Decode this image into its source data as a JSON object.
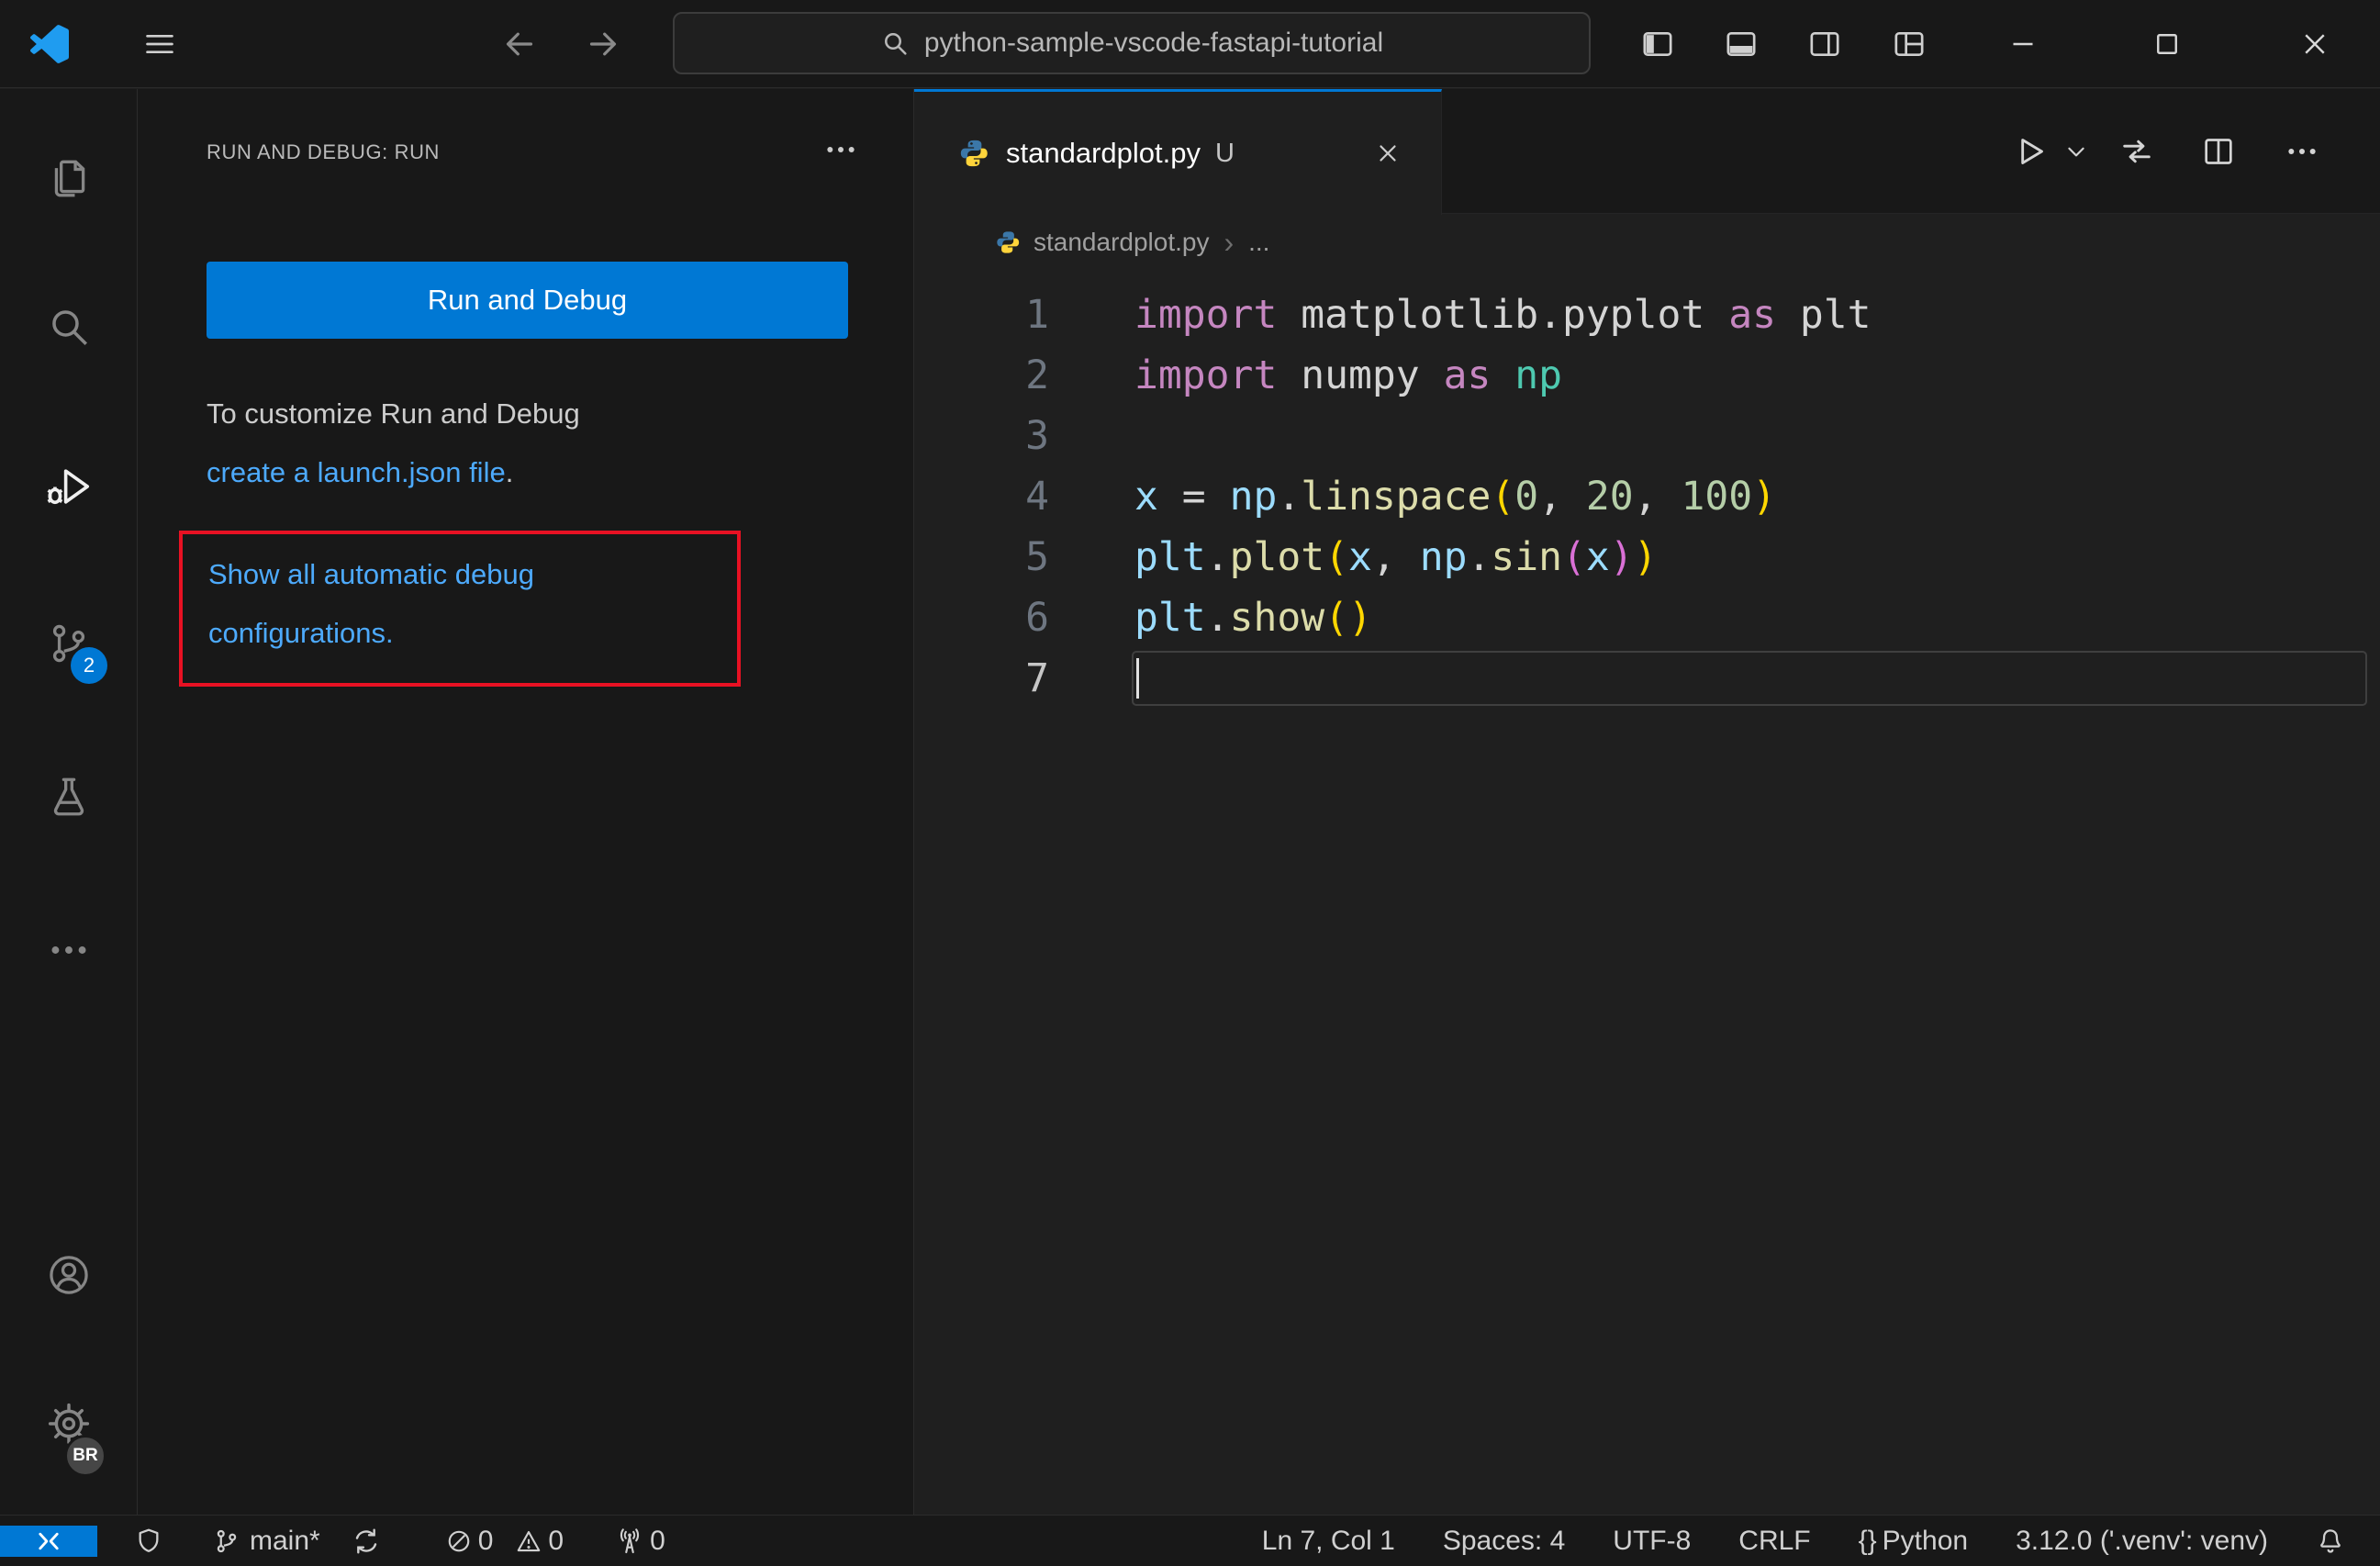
{
  "colors": {
    "accent": "#0078d4",
    "link_blue": "#4daafc",
    "highlight_red": "#e81123",
    "titlebar_bg": "#181818",
    "editor_bg": "#1f1f1f",
    "keyword": "#C586C0",
    "variable": "#9CDCFE",
    "function": "#DCDCAA",
    "number": "#B5CEA8",
    "bracket1": "#FFD700",
    "bracket2": "#DA70D6"
  },
  "title_bar": {
    "search": "python-sample-vscode-fastapi-tutorial"
  },
  "activity_bar": {
    "scm_badge": "2",
    "profile_badge": "BR"
  },
  "sidebar": {
    "header": "RUN AND DEBUG: RUN",
    "run_button": "Run and Debug",
    "hint_text": "To customize Run and Debug",
    "hint_link": "create a launch.json file",
    "hint_period": ".",
    "configs_link": "Show all automatic debug configurations."
  },
  "editor": {
    "tab": {
      "name": "standardplot.py",
      "git_status": "U"
    },
    "breadcrumb": {
      "file": "standardplot.py",
      "more": "..."
    },
    "lines": [
      {
        "num": "1",
        "tokens": [
          {
            "t": "import ",
            "c": "#C586C0"
          },
          {
            "t": "matplotlib.pyplot",
            "c": "#D4D4D4"
          },
          {
            "t": " ",
            "c": "#D4D4D4"
          },
          {
            "t": "as",
            "c": "#C586C0"
          },
          {
            "t": " plt",
            "c": "#D4D4D4"
          }
        ]
      },
      {
        "num": "2",
        "tokens": [
          {
            "t": "import ",
            "c": "#C586C0"
          },
          {
            "t": "numpy",
            "c": "#D4D4D4"
          },
          {
            "t": " ",
            "c": "#D4D4D4"
          },
          {
            "t": "as",
            "c": "#C586C0"
          },
          {
            "t": " np",
            "c": "#4EC9B0"
          }
        ]
      },
      {
        "num": "3",
        "tokens": []
      },
      {
        "num": "4",
        "tokens": [
          {
            "t": "x",
            "c": "#9CDCFE"
          },
          {
            "t": " = ",
            "c": "#D4D4D4"
          },
          {
            "t": "np",
            "c": "#9CDCFE"
          },
          {
            "t": ".",
            "c": "#D4D4D4"
          },
          {
            "t": "linspace",
            "c": "#DCDCAA"
          },
          {
            "t": "(",
            "c": "#FFD700"
          },
          {
            "t": "0",
            "c": "#B5CEA8"
          },
          {
            "t": ", ",
            "c": "#D4D4D4"
          },
          {
            "t": "20",
            "c": "#B5CEA8"
          },
          {
            "t": ", ",
            "c": "#D4D4D4"
          },
          {
            "t": "100",
            "c": "#B5CEA8"
          },
          {
            "t": ")",
            "c": "#FFD700"
          }
        ]
      },
      {
        "num": "5",
        "tokens": [
          {
            "t": "plt",
            "c": "#9CDCFE"
          },
          {
            "t": ".",
            "c": "#D4D4D4"
          },
          {
            "t": "plot",
            "c": "#DCDCAA"
          },
          {
            "t": "(",
            "c": "#FFD700"
          },
          {
            "t": "x",
            "c": "#9CDCFE"
          },
          {
            "t": ", ",
            "c": "#D4D4D4"
          },
          {
            "t": "np",
            "c": "#9CDCFE"
          },
          {
            "t": ".",
            "c": "#D4D4D4"
          },
          {
            "t": "sin",
            "c": "#DCDCAA"
          },
          {
            "t": "(",
            "c": "#DA70D6"
          },
          {
            "t": "x",
            "c": "#9CDCFE"
          },
          {
            "t": ")",
            "c": "#DA70D6"
          },
          {
            "t": ")",
            "c": "#FFD700"
          }
        ]
      },
      {
        "num": "6",
        "tokens": [
          {
            "t": "plt",
            "c": "#9CDCFE"
          },
          {
            "t": ".",
            "c": "#D4D4D4"
          },
          {
            "t": "show",
            "c": "#DCDCAA"
          },
          {
            "t": "(",
            "c": "#FFD700"
          },
          {
            "t": ")",
            "c": "#FFD700"
          }
        ]
      },
      {
        "num": "7",
        "tokens": [],
        "current": true
      }
    ]
  },
  "status_bar": {
    "branch": "main*",
    "errors": "0",
    "warnings": "0",
    "ports": "0",
    "line_col": "Ln 7, Col 1",
    "spaces": "Spaces: 4",
    "encoding": "UTF-8",
    "eol": "CRLF",
    "language_icon": "{}",
    "language": "Python",
    "interpreter": "3.12.0 ('.venv': venv)"
  }
}
